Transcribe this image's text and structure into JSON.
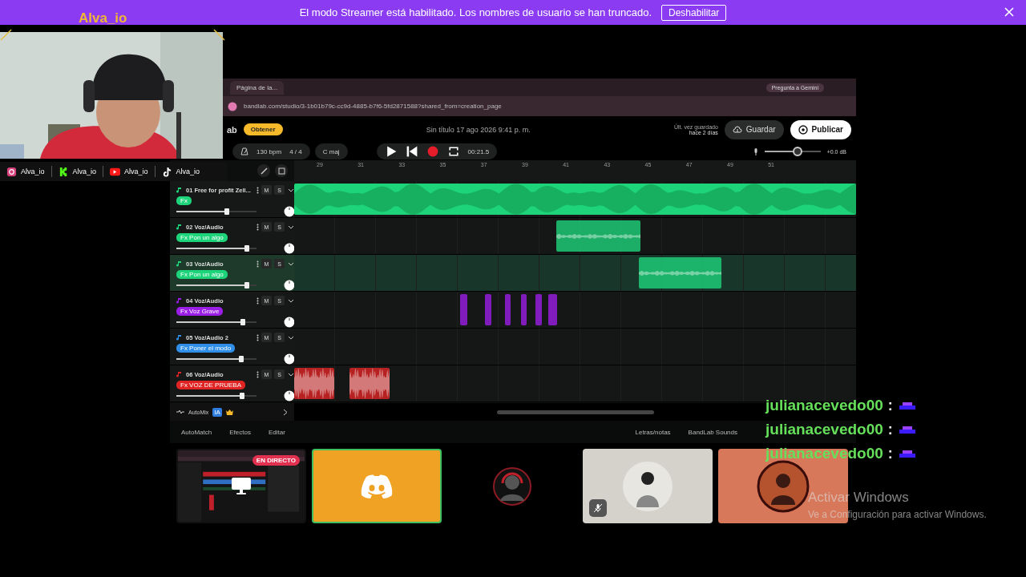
{
  "banner": {
    "message": "El modo Streamer está habilitado. Los nombres de usuario se han truncado.",
    "button": "Deshabilitar"
  },
  "streamer": {
    "name": "Alva_io",
    "socials": [
      {
        "kind": "instagram",
        "handle": "Alva_io"
      },
      {
        "kind": "kick",
        "handle": "Alva_io"
      },
      {
        "kind": "youtube",
        "handle": "Alva_io"
      },
      {
        "kind": "tiktok",
        "handle": "Alva_io"
      }
    ]
  },
  "browser": {
    "tab_title": "Página de la...",
    "url": "bandlab.com/studio/3-1b01b79c-cc9d-4885-b7f6-5fd2871588?shared_from=creation_page",
    "assistant_button": "Pregunta a Gemini"
  },
  "studio": {
    "brand_fragment": "ab",
    "get_button": "Obtener",
    "project_title": "Sin título 17 ago 2026 9:41 p. m.",
    "save_status": "Últ. vez guardado",
    "save_age": "hace 2 días",
    "save_button": "Guardar",
    "publish_button": "Publicar"
  },
  "transport": {
    "tempo": "130 bpm",
    "meter": "4 / 4",
    "key": "C maj",
    "time": "00:21.5",
    "volume": {
      "level": 0.5,
      "reading": "+0.0 dB"
    }
  },
  "ruler": [
    "29",
    "31",
    "33",
    "35",
    "37",
    "39",
    "41",
    "43",
    "45",
    "47",
    "49",
    "51"
  ],
  "tracks": [
    {
      "number": "01",
      "name": "Free for profit Zell...",
      "tag": "Fx",
      "color": "#1ed47a",
      "selected": false,
      "level": 0.6,
      "mute": "M",
      "solo": "S"
    },
    {
      "number": "02",
      "name": "Voz/Audio",
      "tag": "Fx Pon un algo",
      "color": "#1ed47a",
      "selected": false,
      "level": 0.85,
      "mute": "M",
      "solo": "S"
    },
    {
      "number": "03",
      "name": "Voz/Audio",
      "tag": "Fx Pon un algo",
      "color": "#1ed47a",
      "selected": true,
      "level": 0.85,
      "mute": "M",
      "solo": "S"
    },
    {
      "number": "04",
      "name": "Voz/Audio",
      "tag": "Fx Voz Grave",
      "color": "#9b1ee6",
      "selected": false,
      "level": 0.8,
      "mute": "M",
      "solo": "S"
    },
    {
      "number": "05",
      "name": "Voz/Audio 2",
      "tag": "Fx Poner el modo",
      "color": "#2f8ee8",
      "selected": false,
      "level": 0.78,
      "mute": "M",
      "solo": "S"
    },
    {
      "number": "06",
      "name": "Voz/Audio",
      "tag": "Fx VOZ DE PRUEBA",
      "color": "#e02424",
      "selected": false,
      "level": 0.79,
      "mute": "M",
      "solo": "S"
    }
  ],
  "automix": {
    "label": "AutoMix",
    "badge": "IA"
  },
  "tools_left": [
    "AutoMatch",
    "Efectos",
    "Editar"
  ],
  "tools_right": [
    "Letras/notas",
    "BandLab Sounds"
  ],
  "tiles": [
    {
      "kind": "screen",
      "badge": "EN DIRECTO",
      "selected": false
    },
    {
      "kind": "discord",
      "selected": true
    },
    {
      "kind": "avatar-dark",
      "selected": false
    },
    {
      "kind": "avatar-light",
      "muted": true,
      "selected": false
    },
    {
      "kind": "avatar-coral",
      "selected": false
    }
  ],
  "chat": [
    {
      "user": "julianacevedo00",
      "separator": ":"
    },
    {
      "user": "julianacevedo00",
      "separator": ":"
    },
    {
      "user": "julianacevedo00",
      "separator": ":"
    }
  ],
  "windows_notice": {
    "title": "Activar Windows",
    "subtitle": "Ve a Configuración para activar Windows."
  }
}
